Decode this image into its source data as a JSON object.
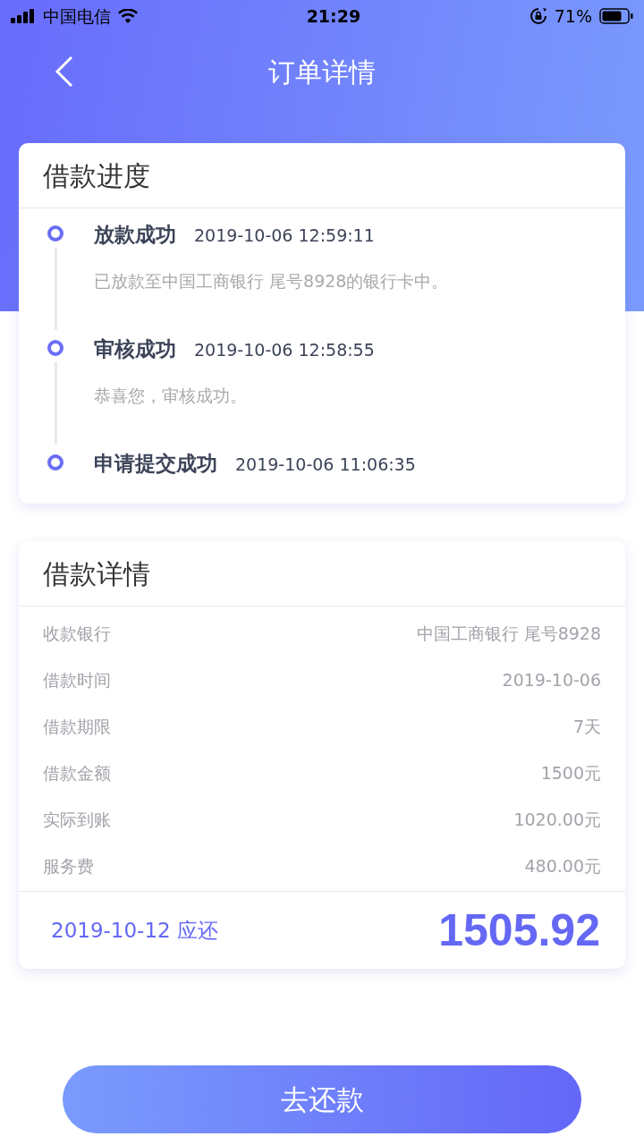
{
  "status_bar": {
    "carrier": "中国电信",
    "time": "21:29",
    "battery": "71%"
  },
  "nav": {
    "title": "订单详情"
  },
  "progress": {
    "title": "借款进度",
    "events": [
      {
        "title": "放款成功",
        "time": "2019-10-06 12:59:11",
        "desc": "已放款至中国工商银行 尾号8928的银行卡中。"
      },
      {
        "title": "审核成功",
        "time": "2019-10-06 12:58:55",
        "desc": "恭喜您，审核成功。"
      },
      {
        "title": "申请提交成功",
        "time": "2019-10-06 11:06:35"
      }
    ]
  },
  "details": {
    "title": "借款详情",
    "rows": [
      {
        "label": "收款银行",
        "value": "中国工商银行 尾号8928"
      },
      {
        "label": "借款时间",
        "value": "2019-10-06"
      },
      {
        "label": "借款期限",
        "value": "7天"
      },
      {
        "label": "借款金额",
        "value": "1500元"
      },
      {
        "label": "实际到账",
        "value": "1020.00元"
      },
      {
        "label": "服务费",
        "value": "480.00元"
      }
    ],
    "due": "2019-10-12 应还",
    "amount": "1505.92"
  },
  "button": "去还款"
}
